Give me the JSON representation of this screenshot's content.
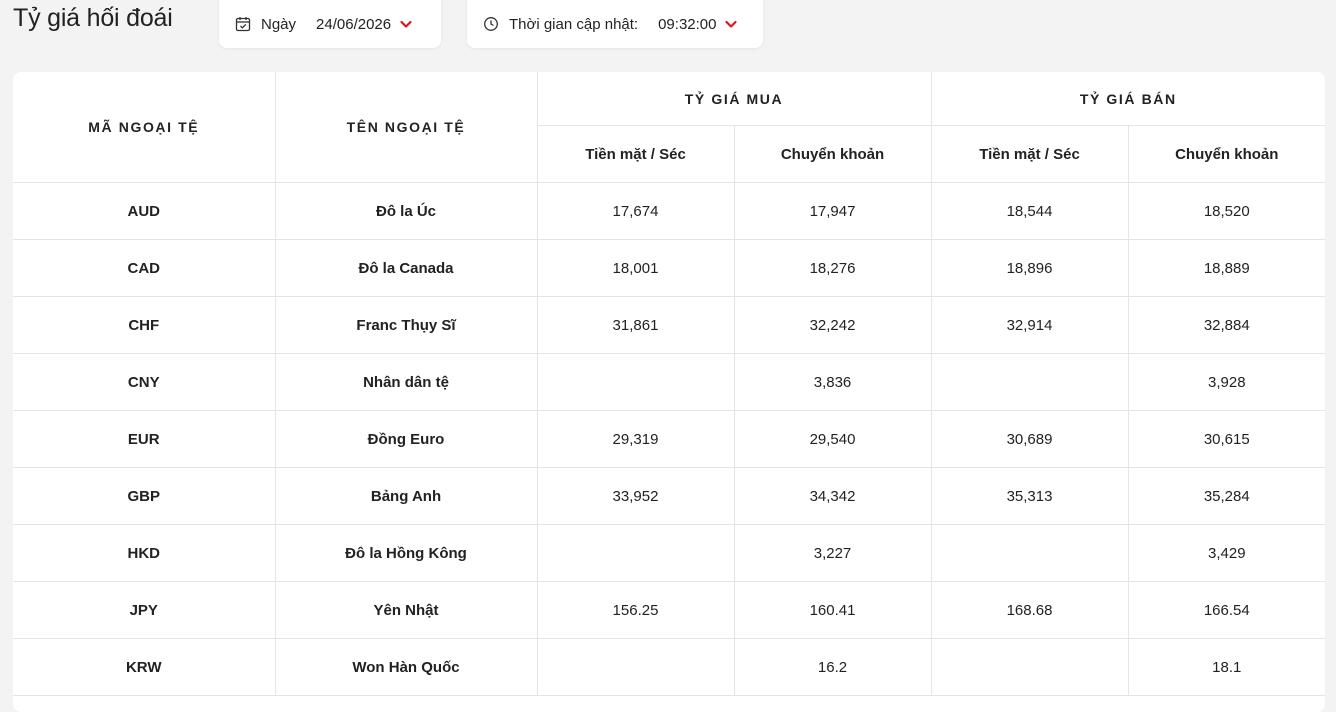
{
  "page": {
    "title": "Tỷ giá hối đoái"
  },
  "filters": {
    "date": {
      "icon": "calendar-check-icon",
      "label": "Ngày",
      "value": "24/06/2026"
    },
    "time": {
      "icon": "clock-icon",
      "label": "Thời gian cập nhật:",
      "value": "09:32:00"
    },
    "chevron_color": "#e0141e"
  },
  "table": {
    "headers": {
      "code": "MÃ NGOẠI TỆ",
      "name": "TÊN NGOẠI TỆ",
      "buy": "TỶ GIÁ MUA",
      "sell": "TỶ GIÁ BÁN",
      "cash": "Tiền mặt / Séc",
      "transfer": "Chuyển khoản"
    },
    "rows": [
      {
        "code": "AUD",
        "name": "Đô la Úc",
        "buy_cash": "17,674",
        "buy_transfer": "17,947",
        "sell_cash": "18,544",
        "sell_transfer": "18,520"
      },
      {
        "code": "CAD",
        "name": "Đô la Canada",
        "buy_cash": "18,001",
        "buy_transfer": "18,276",
        "sell_cash": "18,896",
        "sell_transfer": "18,889"
      },
      {
        "code": "CHF",
        "name": "Franc Thụy Sĩ",
        "buy_cash": "31,861",
        "buy_transfer": "32,242",
        "sell_cash": "32,914",
        "sell_transfer": "32,884"
      },
      {
        "code": "CNY",
        "name": "Nhân dân tệ",
        "buy_cash": "",
        "buy_transfer": "3,836",
        "sell_cash": "",
        "sell_transfer": "3,928"
      },
      {
        "code": "EUR",
        "name": "Đồng Euro",
        "buy_cash": "29,319",
        "buy_transfer": "29,540",
        "sell_cash": "30,689",
        "sell_transfer": "30,615"
      },
      {
        "code": "GBP",
        "name": "Bảng Anh",
        "buy_cash": "33,952",
        "buy_transfer": "34,342",
        "sell_cash": "35,313",
        "sell_transfer": "35,284"
      },
      {
        "code": "HKD",
        "name": "Đô la Hồng Kông",
        "buy_cash": "",
        "buy_transfer": "3,227",
        "sell_cash": "",
        "sell_transfer": "3,429"
      },
      {
        "code": "JPY",
        "name": "Yên Nhật",
        "buy_cash": "156.25",
        "buy_transfer": "160.41",
        "sell_cash": "168.68",
        "sell_transfer": "166.54"
      },
      {
        "code": "KRW",
        "name": "Won Hàn Quốc",
        "buy_cash": "",
        "buy_transfer": "16.2",
        "sell_cash": "",
        "sell_transfer": "18.1"
      }
    ]
  }
}
